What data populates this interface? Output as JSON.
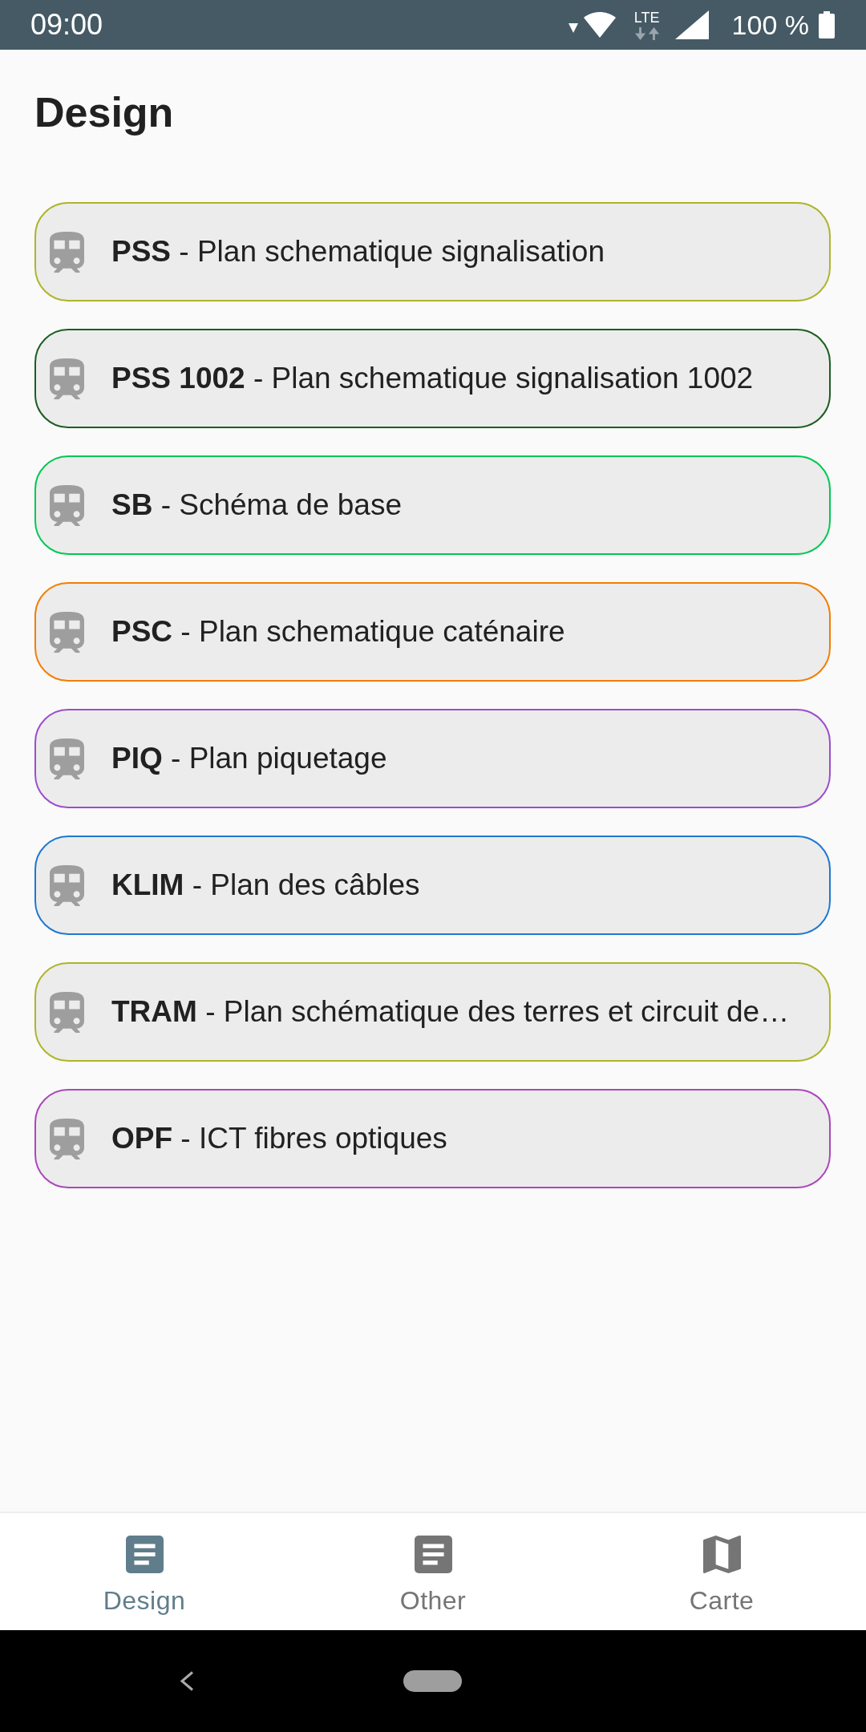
{
  "status_bar": {
    "time": "09:00",
    "network": "LTE",
    "battery": "100 %"
  },
  "header": {
    "title": "Design"
  },
  "items": [
    {
      "label": "**PSS** - Plan schematique signalisation",
      "color": "#afb42b"
    },
    {
      "label": "**PSS 1002** - Plan schematique signalisation 1002",
      "color": "#1b5e20"
    },
    {
      "label": "**SB** - Schéma de base",
      "color": "#00c853"
    },
    {
      "label": "**PSC** - Plan schematique caténaire",
      "color": "#f57c00"
    },
    {
      "label": "**PIQ** - Plan piquetage",
      "color": "#9c4dcc"
    },
    {
      "label": "**KLIM** - Plan des câbles",
      "color": "#1e78d2"
    },
    {
      "label": "**TRAM** - Plan schématique des terres et circuit de…",
      "color": "#afb42b"
    },
    {
      "label": "**OPF** - ICT fibres optiques",
      "color": "#ab47bc"
    }
  ],
  "bottom_nav": [
    {
      "label": "Design",
      "kind": "document",
      "selected": true
    },
    {
      "label": "Other",
      "kind": "document",
      "selected": false
    },
    {
      "label": "Carte",
      "kind": "map",
      "selected": false
    }
  ]
}
